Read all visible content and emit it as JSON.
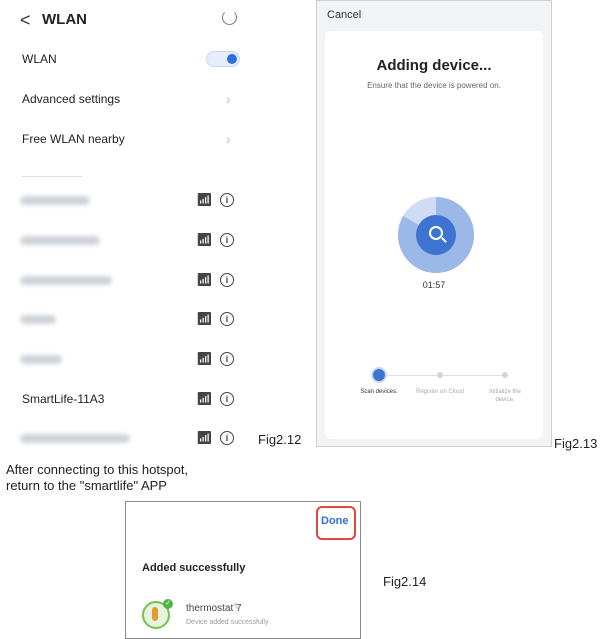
{
  "wlan_screen": {
    "back_symbol": "<",
    "title": "WLAN",
    "rows": [
      {
        "label": "WLAN",
        "type": "toggle",
        "on": true
      },
      {
        "label": "Advanced settings",
        "type": "nav"
      },
      {
        "label": "Free WLAN nearby",
        "type": "nav"
      }
    ],
    "networks": [
      {
        "ssid": "",
        "blurred": true,
        "secure": true
      },
      {
        "ssid": "",
        "blurred": true,
        "secure": true
      },
      {
        "ssid": "",
        "blurred": true,
        "secure": true
      },
      {
        "ssid": "",
        "blurred": true,
        "secure": true
      },
      {
        "ssid": "",
        "blurred": true,
        "secure": true
      },
      {
        "ssid": "SmartLife-11A3",
        "blurred": false,
        "secure": false
      },
      {
        "ssid": "",
        "blurred": true,
        "secure": true
      }
    ],
    "caption": "Fig2.12",
    "note_line1": "After connecting to this hotspot,",
    "note_line2": "return to the \"smartlife\" APP"
  },
  "adding_screen": {
    "cancel_label": "Cancel",
    "title": "Adding device...",
    "subtitle": "Ensure that the device is powered on.",
    "countdown": "01:57",
    "steps": [
      {
        "label": "Scan devices.",
        "active": true
      },
      {
        "label": "Register on Cloud",
        "active": false
      },
      {
        "label": "Initialize the device.",
        "active": false
      }
    ],
    "caption": "Fig2.13",
    "accent_color": "#3d73d1"
  },
  "success_screen": {
    "done_label": "Done",
    "title": "Added successfully",
    "device_name": "thermostat 7",
    "device_status": "Device added successfully",
    "caption": "Fig2.14",
    "highlight_color": "#e0453f"
  }
}
